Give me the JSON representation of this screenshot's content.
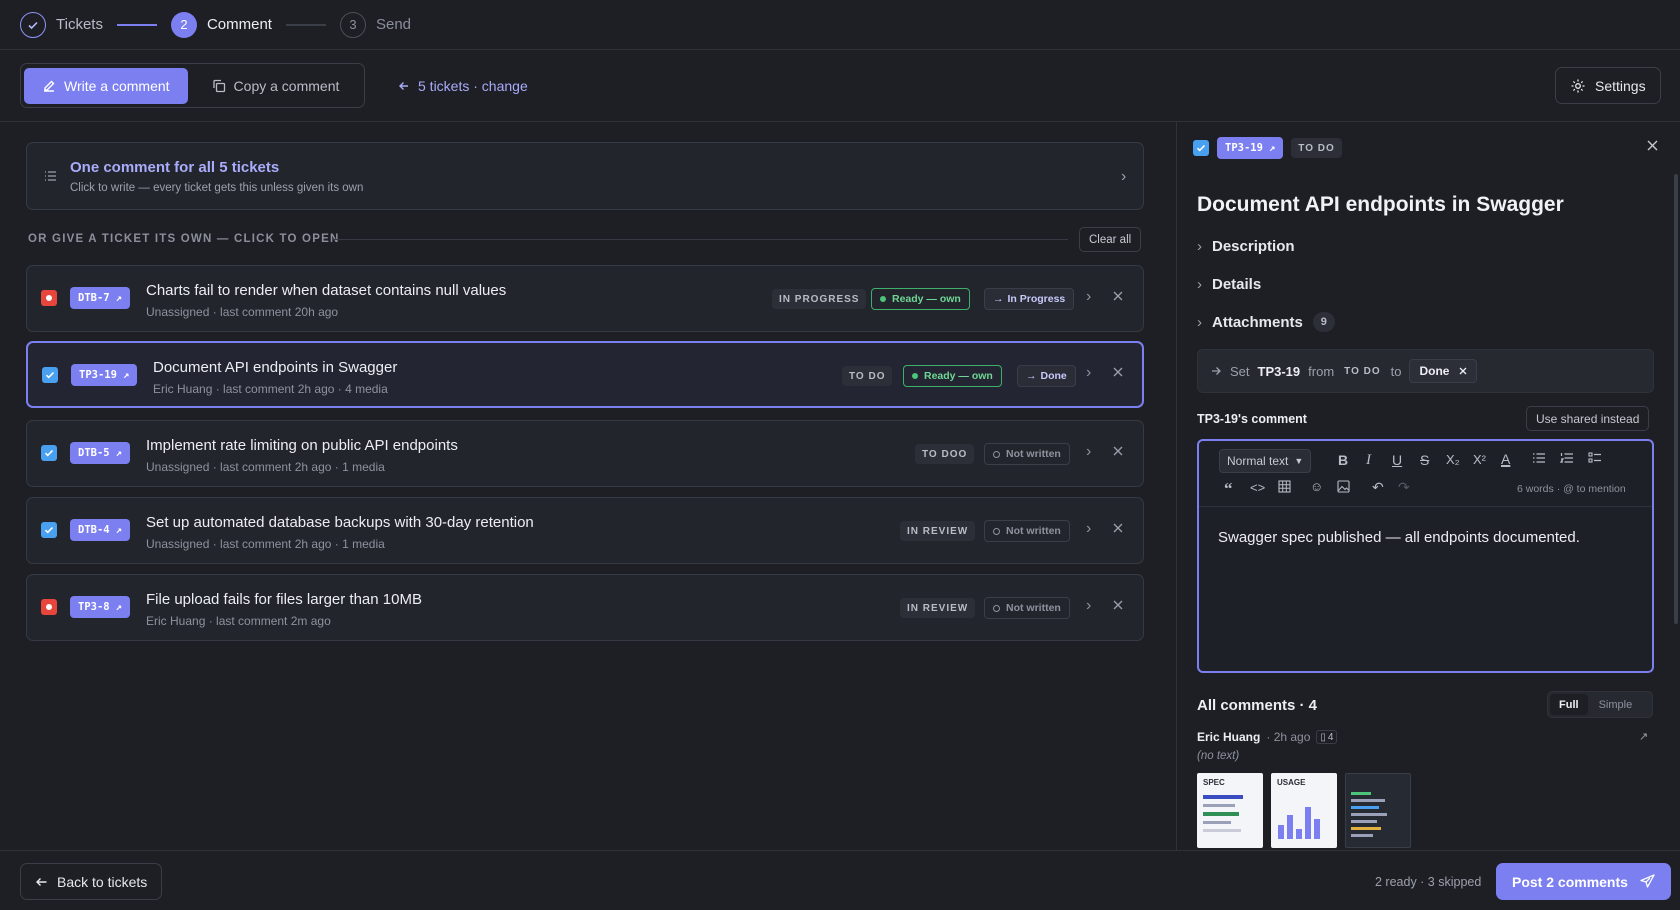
{
  "stepper": {
    "steps": [
      {
        "number": "✓",
        "label": "Tickets",
        "state": "done"
      },
      {
        "number": "2",
        "label": "Comment",
        "state": "active"
      },
      {
        "number": "3",
        "label": "Send",
        "state": "todo"
      }
    ]
  },
  "toolbar": {
    "write_label": "Write a comment",
    "copy_label": "Copy a comment",
    "tickets_link": "5 tickets · change",
    "settings_label": "Settings"
  },
  "shared": {
    "title": "One comment for all 5 tickets",
    "subtitle": "Click to write — every ticket gets this unless given its own"
  },
  "divider": {
    "label": "OR GIVE A TICKET ITS OWN — CLICK TO OPEN",
    "clear_label": "Clear all"
  },
  "tickets": [
    {
      "key": "DTB-7",
      "title": "Charts fail to render when dataset contains null values",
      "meta": "Unassigned · last comment 20h ago",
      "status": "IN PROGRESS",
      "state": "Ready — own",
      "target": "In Progress",
      "checkbox": "red"
    },
    {
      "key": "TP3-19",
      "title": "Document API endpoints in Swagger",
      "meta": "Eric Huang · last comment 2h ago · 4 media",
      "status": "TO DO",
      "state": "Ready — own",
      "target": "Done",
      "checkbox": "checked"
    },
    {
      "key": "DTB-5",
      "title": "Implement rate limiting on public API endpoints",
      "meta": "Unassigned · last comment 2h ago · 1 media",
      "status": "TO DOO",
      "state": "Not written",
      "target": "",
      "checkbox": "checked"
    },
    {
      "key": "DTB-4",
      "title": "Set up automated database backups with 30-day retention",
      "meta": "Unassigned · last comment 2h ago · 1 media",
      "status": "IN REVIEW",
      "state": "Not written",
      "target": "",
      "checkbox": "checked"
    },
    {
      "key": "TP3-8",
      "title": "File upload fails for files larger than 10MB",
      "meta": "Eric Huang · last comment 2m ago",
      "status": "IN REVIEW",
      "state": "Not written",
      "target": "",
      "checkbox": "red"
    }
  ],
  "detail": {
    "key": "TP3-19",
    "status": "TO DO",
    "title": "Document API endpoints in Swagger",
    "sections": [
      "Description",
      "Details",
      "Attachments"
    ],
    "attachments_count": "9",
    "transition": {
      "prefix": "Set",
      "key": "TP3-19",
      "from_word": "from",
      "from_status": "TO DO",
      "to_word": "to",
      "to_status": "Done"
    },
    "comment_label": "TP3-19's comment",
    "use_shared_label": "Use shared instead",
    "editor": {
      "block_type": "Normal text",
      "word_count": "6 words",
      "mention_hint": "· @ to mention",
      "text": "Swagger spec published — all endpoints documented."
    },
    "all_comments": "All comments · 4",
    "view_full": "Full",
    "view_simple": "Simple",
    "comment": {
      "author": "Eric Huang",
      "time": "· 2h ago",
      "media_count": "4",
      "body": "(no text)",
      "thumbs": [
        "SPEC",
        "USAGE",
        ""
      ]
    }
  },
  "footer": {
    "back_label": "Back to tickets",
    "summary": "2 ready · 3 skipped",
    "post_label": "Post 2 comments"
  },
  "colors": {
    "accent": "#7c7ff0",
    "background": "#1d1f25",
    "checkbox_blue": "#4aa0f0",
    "checkbox_red": "#e8453c",
    "ready_green": "#4cc47a"
  }
}
